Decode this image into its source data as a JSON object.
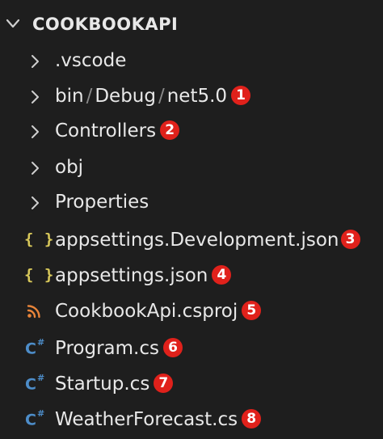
{
  "explorer": {
    "root": {
      "label": "COOKBOOKAPI",
      "expanded": true
    },
    "items": [
      {
        "kind": "folder",
        "label": ".vscode",
        "icon": "chevron-right-icon"
      },
      {
        "kind": "folder",
        "segments": [
          "bin",
          "Debug",
          "net5.0"
        ],
        "separator": "/",
        "icon": "chevron-right-icon",
        "badge": "1"
      },
      {
        "kind": "folder",
        "label": "Controllers",
        "icon": "chevron-right-icon",
        "badge": "2"
      },
      {
        "kind": "folder",
        "label": "obj",
        "icon": "chevron-right-icon"
      },
      {
        "kind": "folder",
        "label": "Properties",
        "icon": "chevron-right-icon"
      },
      {
        "kind": "json",
        "label": "appsettings.Development.json",
        "icon": "json-braces-icon",
        "icon_text": "{ }",
        "badge": "3"
      },
      {
        "kind": "json",
        "label": "appsettings.json",
        "icon": "json-braces-icon",
        "icon_text": "{ }",
        "badge": "4"
      },
      {
        "kind": "csproj",
        "label": "CookbookApi.csproj",
        "icon": "rss-icon",
        "badge": "5"
      },
      {
        "kind": "cs",
        "label": "Program.cs",
        "icon": "csharp-icon",
        "icon_text": "C",
        "icon_sup": "#",
        "badge": "6"
      },
      {
        "kind": "cs",
        "label": "Startup.cs",
        "icon": "csharp-icon",
        "icon_text": "C",
        "icon_sup": "#",
        "badge": "7"
      },
      {
        "kind": "cs",
        "label": "WeatherForecast.cs",
        "icon": "csharp-icon",
        "icon_text": "C",
        "icon_sup": "#",
        "badge": "8"
      }
    ]
  },
  "colors": {
    "background": "#1e1e1e",
    "text": "#e8e8e8",
    "json_icon": "#d8c85a",
    "rss_icon": "#e8843a",
    "csharp_icon": "#4d8dc9",
    "badge": "#e0211b"
  }
}
